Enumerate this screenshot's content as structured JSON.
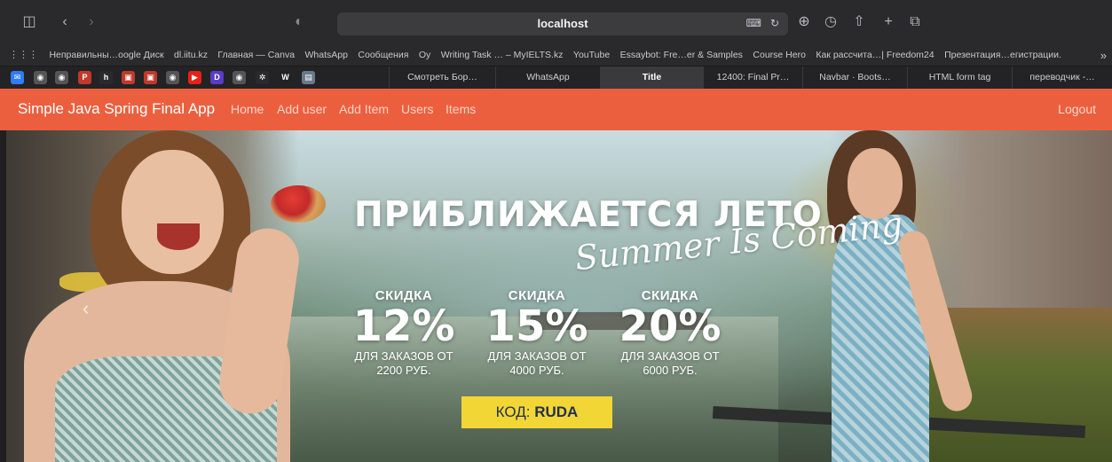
{
  "browser": {
    "url": "localhost",
    "bookmarks": [
      "Неправильны…oogle Диск",
      "dl.iitu.kz",
      "Главная — Canva",
      "WhatsApp",
      "Сообщения",
      "Oy",
      "Writing Task … – MyIELTS.kz",
      "YouTube",
      "Essaybot: Fre…er & Samples",
      "Course Hero",
      "Как рассчита…| Freedom24",
      "Презентация…егистрации."
    ],
    "favicons": [
      {
        "name": "mail-favicon",
        "glyph": "✉",
        "color": "#2f7cf6"
      },
      {
        "name": "github-favicon",
        "glyph": "◉",
        "color": "#555"
      },
      {
        "name": "github-favicon",
        "glyph": "◉",
        "color": "#555"
      },
      {
        "name": "pecb-favicon",
        "glyph": "P",
        "color": "#c0392b"
      },
      {
        "name": "h-favicon",
        "glyph": "h",
        "color": "#2a2a2c"
      },
      {
        "name": "app-favicon",
        "glyph": "▣",
        "color": "#c0392b"
      },
      {
        "name": "app-favicon",
        "glyph": "▣",
        "color": "#c0392b"
      },
      {
        "name": "github-favicon",
        "glyph": "◉",
        "color": "#555"
      },
      {
        "name": "youtube-favicon",
        "glyph": "▶",
        "color": "#e62117"
      },
      {
        "name": "d-favicon",
        "glyph": "D",
        "color": "#5b3cc4"
      },
      {
        "name": "github-favicon",
        "glyph": "◉",
        "color": "#555"
      },
      {
        "name": "spinner-favicon",
        "glyph": "✲",
        "color": "#2a2a2c"
      },
      {
        "name": "wix-favicon",
        "glyph": "W",
        "color": "#222"
      },
      {
        "name": "doc-favicon",
        "glyph": "▤",
        "color": "#6a7a8a"
      }
    ],
    "tabs": [
      "Смотреть Бор…",
      "WhatsApp",
      "Title",
      "12400: Final Pr…",
      "Navbar · Boots…",
      "HTML form tag",
      "переводчик -…"
    ],
    "active_tab": "Title"
  },
  "navbar": {
    "brand": "Simple Java Spring Final App",
    "links": [
      "Home",
      "Add user",
      "Add Item",
      "Users",
      "Items"
    ],
    "logout": "Logout",
    "color": "#ec5f3e"
  },
  "hero": {
    "headline": "ПРИБЛИЖАЕТСЯ ЛЕТО",
    "script_text": "Summer Is Coming",
    "offers": [
      {
        "label": "СКИДКА",
        "percent": "12%",
        "desc_line1": "ДЛЯ ЗАКАЗОВ ОТ",
        "desc_line2": "2200 РУБ."
      },
      {
        "label": "СКИДКА",
        "percent": "15%",
        "desc_line1": "ДЛЯ ЗАКАЗОВ ОТ",
        "desc_line2": "4000 РУБ."
      },
      {
        "label": "СКИДКА",
        "percent": "20%",
        "desc_line1": "ДЛЯ ЗАКАЗОВ ОТ",
        "desc_line2": "6000 РУБ."
      }
    ],
    "code_label": "КОД:",
    "code_value": "RUDA",
    "code_color": "#f2d636"
  }
}
